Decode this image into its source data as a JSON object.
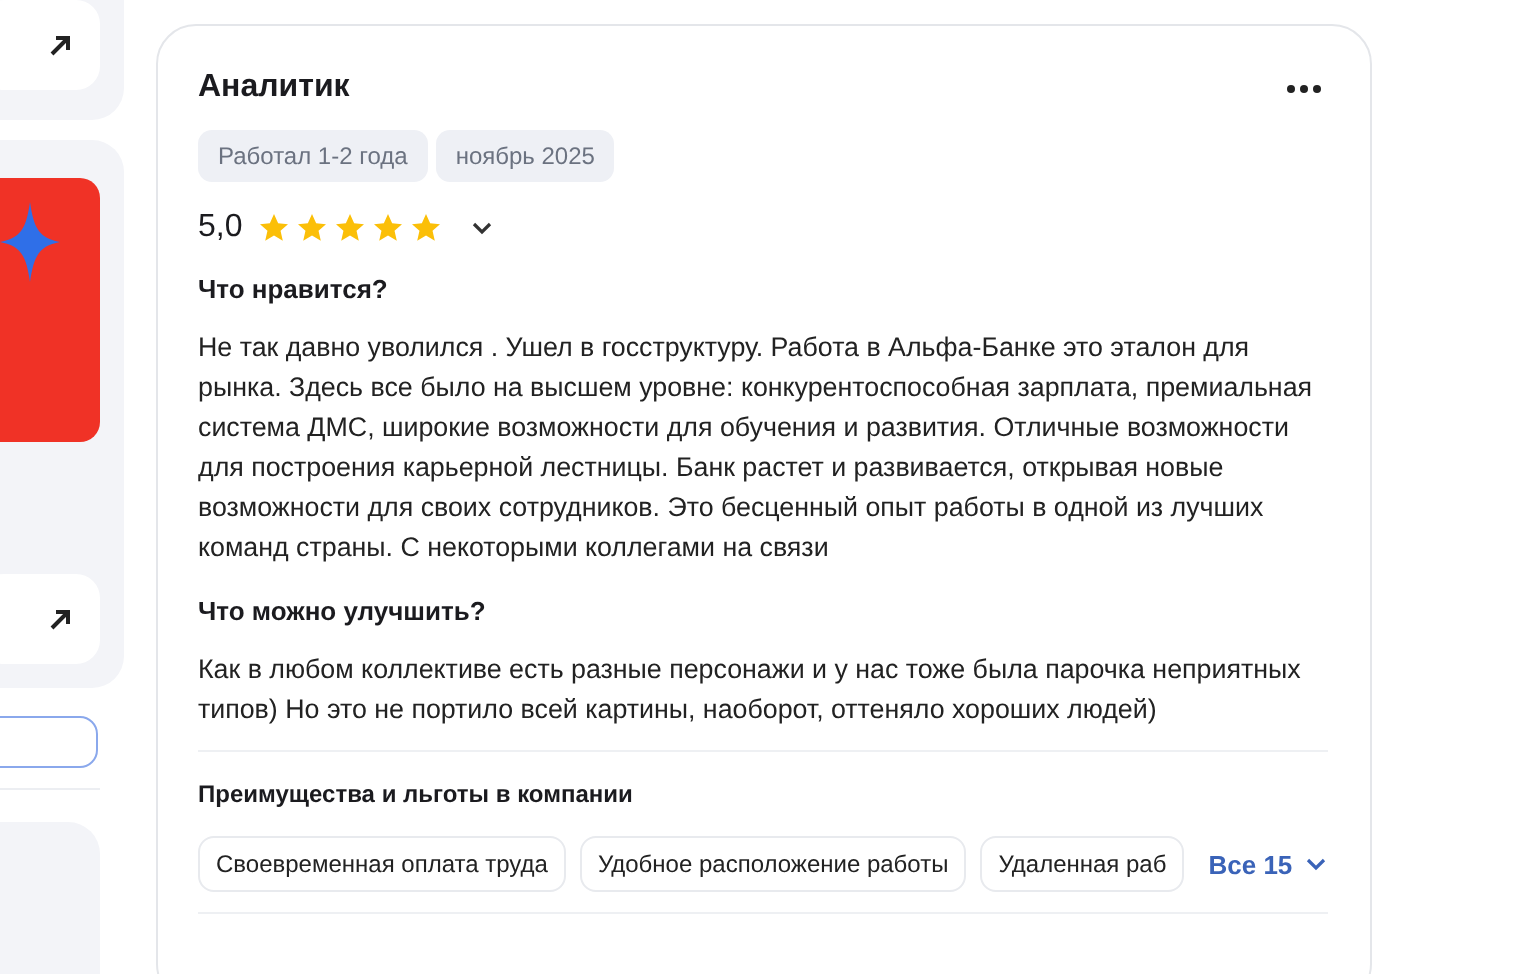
{
  "review": {
    "title": "Аналитик",
    "tags": [
      "Работал 1-2 года",
      "ноябрь 2025"
    ],
    "rating": "5,0",
    "stars": 5,
    "sections": [
      {
        "heading": "Что нравится?",
        "text": "Не так давно уволился . Ушел в госструктуру. Работа в Альфа-Банке это эталон для рынка. Здесь все было на высшем уровне: конкурентоспособная зарплата, премиальная система ДМС, широкие возможности для обучения и развития. Отличные возможности для построения карьерной лестницы. Банк растет и развивается, открывая новые возможности для своих сотрудников. Это бесценный опыт работы в одной из лучших команд страны. С некоторыми коллегами на связи"
      },
      {
        "heading": "Что можно улучшить?",
        "text": "Как в любом коллективе есть разные персонажи и у нас тоже была парочка неприятных типов) Но это не портило всей картины, наоборот, оттеняло хороших людей)"
      }
    ],
    "benefits": {
      "heading": "Преимущества и льготы в компании",
      "items": [
        "Своевременная оплата труда",
        "Удобное расположение работы",
        "Удаленная раб"
      ],
      "more": "Все 15"
    }
  }
}
